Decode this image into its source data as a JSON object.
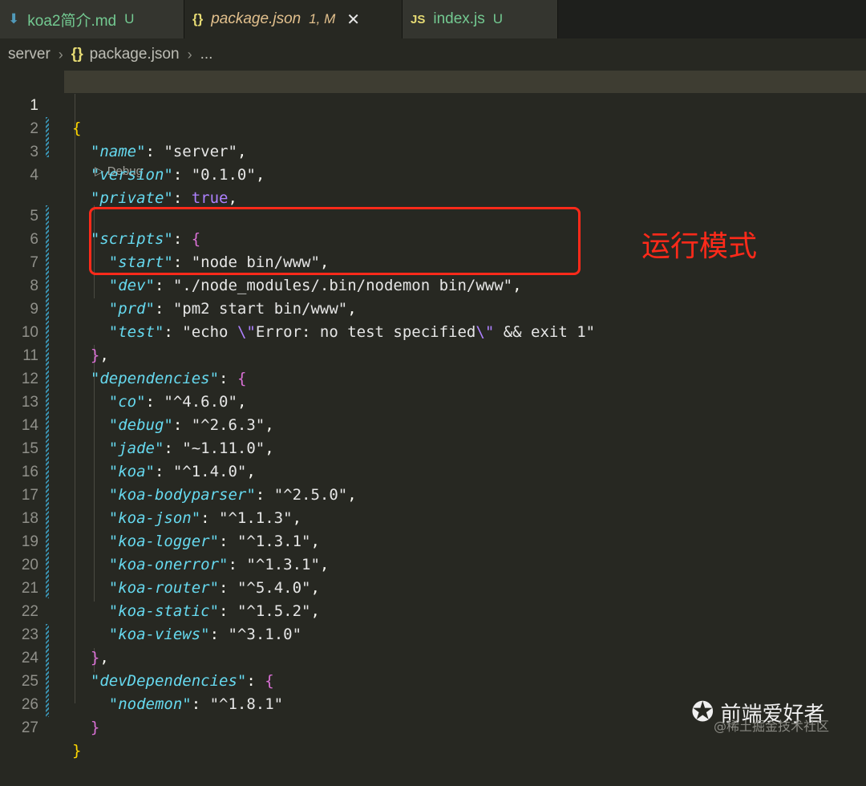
{
  "tabs": [
    {
      "icon": "⬇",
      "name": "koa2简介.md",
      "badge": "U"
    },
    {
      "icon": "{}",
      "name": "package.json",
      "badge": "1, M",
      "close": "✕"
    },
    {
      "icon": "JS",
      "name": "index.js",
      "badge": "U"
    }
  ],
  "breadcrumb": {
    "folder": "server",
    "file_icon": "{}",
    "file": "package.json",
    "more": "...",
    "separator": "›"
  },
  "codelens": "▷ Debug",
  "annotation": "运行模式",
  "watermark": {
    "logo": "✪",
    "title": "前端爱好者",
    "sub": "@稀土掘金技术社区"
  },
  "line_numbers": [
    "1",
    "2",
    "3",
    "4",
    "5",
    "6",
    "7",
    "8",
    "9",
    "10",
    "11",
    "12",
    "13",
    "14",
    "15",
    "16",
    "17",
    "18",
    "19",
    "20",
    "21",
    "22",
    "23",
    "24",
    "25",
    "26",
    "27"
  ],
  "code": {
    "open_brace": "{",
    "name": {
      "key": "\"name\"",
      "value": "\"server\""
    },
    "version": {
      "key": "\"version\"",
      "value": "\"0.1.0\""
    },
    "private": {
      "key": "\"private\"",
      "value": "true"
    },
    "scripts_key": "\"scripts\"",
    "start": {
      "key": "\"start\"",
      "value": "\"node bin/www\""
    },
    "dev": {
      "key": "\"dev\"",
      "value": "\"./node_modules/.bin/nodemon bin/www\""
    },
    "prd": {
      "key": "\"prd\"",
      "value": "\"pm2 start bin/www\""
    },
    "test": {
      "key": "\"test\"",
      "v1": "\"echo ",
      "e1": "\\\"",
      "v2": "Error: no test specified",
      "e2": "\\\"",
      "v3": " && exit 1\""
    },
    "dependencies_key": "\"dependencies\"",
    "deps": [
      {
        "key": "\"co\"",
        "value": "\"^4.6.0\""
      },
      {
        "key": "\"debug\"",
        "value": "\"^2.6.3\""
      },
      {
        "key": "\"jade\"",
        "value": "\"~1.11.0\""
      },
      {
        "key": "\"koa\"",
        "value": "\"^1.4.0\""
      },
      {
        "key": "\"koa-bodyparser\"",
        "value": "\"^2.5.0\""
      },
      {
        "key": "\"koa-json\"",
        "value": "\"^1.1.3\""
      },
      {
        "key": "\"koa-logger\"",
        "value": "\"^1.3.1\""
      },
      {
        "key": "\"koa-onerror\"",
        "value": "\"^1.3.1\""
      },
      {
        "key": "\"koa-router\"",
        "value": "\"^5.4.0\""
      },
      {
        "key": "\"koa-static\"",
        "value": "\"^1.5.2\""
      },
      {
        "key": "\"koa-views\"",
        "value": "\"^3.1.0\""
      }
    ],
    "devDependencies_key": "\"devDependencies\"",
    "nodemon": {
      "key": "\"nodemon\"",
      "value": "\"^1.8.1\""
    },
    "close_brace": "}"
  },
  "colors": {
    "background": "#272822",
    "key": "#66d9ef",
    "bool": "#ae81ff",
    "highlight_box": "#ff2a1a"
  }
}
